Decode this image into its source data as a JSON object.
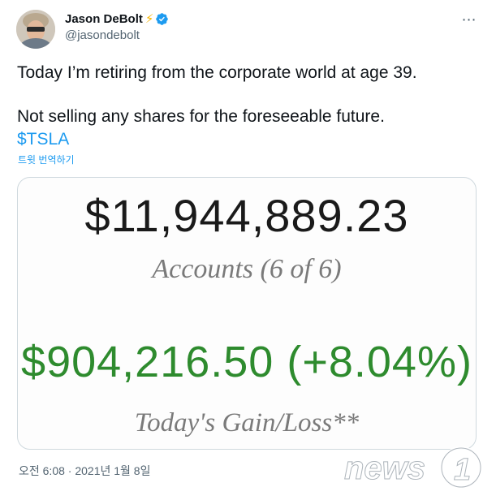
{
  "author": {
    "display_name": "Jason DeBolt",
    "handle": "@jasondebolt",
    "name_emoji": "⚡"
  },
  "menu": {
    "more_icon": "⋯"
  },
  "tweet": {
    "line1": "Today I’m retiring from the corporate world at age 39.",
    "line2": "Not selling any shares for the foreseeable future.",
    "cashtag": "$TSLA",
    "translate_label": "트윗 번역하기",
    "timestamp": "오전 6:08 · 2021년 1월 8일"
  },
  "media": {
    "balance": "$11,944,889.23",
    "accounts_label": "Accounts (6 of 6)",
    "gain": "$904,216.50 (+8.04%)",
    "gain_label": "Today's Gain/Loss**"
  },
  "watermark": {
    "brand": "news1"
  },
  "colors": {
    "link": "#1d9bf0",
    "verified": "#1d9bf0",
    "gain": "#2e8b2e",
    "text": "#0f1419",
    "secondary": "#536471"
  }
}
